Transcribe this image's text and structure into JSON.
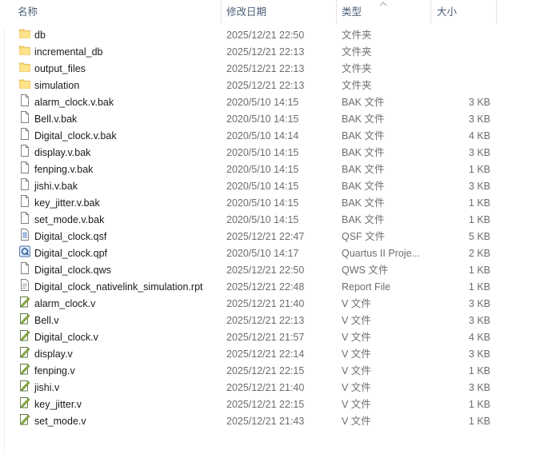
{
  "columns": {
    "name": "名称",
    "date": "修改日期",
    "type": "类型",
    "size": "大小"
  },
  "sort": {
    "column": "type",
    "direction": "ascending",
    "icon": "sort-up-icon"
  },
  "files": [
    {
      "name": "db",
      "date": "2025/12/21 22:50",
      "type": "文件夹",
      "size": "",
      "icon": "folder-icon"
    },
    {
      "name": "incremental_db",
      "date": "2025/12/21 22:13",
      "type": "文件夹",
      "size": "",
      "icon": "folder-icon"
    },
    {
      "name": "output_files",
      "date": "2025/12/21 22:13",
      "type": "文件夹",
      "size": "",
      "icon": "folder-icon"
    },
    {
      "name": "simulation",
      "date": "2025/12/21 22:13",
      "type": "文件夹",
      "size": "",
      "icon": "folder-icon"
    },
    {
      "name": "alarm_clock.v.bak",
      "date": "2020/5/10 14:15",
      "type": "BAK 文件",
      "size": "3 KB",
      "icon": "file-icon"
    },
    {
      "name": "Bell.v.bak",
      "date": "2020/5/10 14:15",
      "type": "BAK 文件",
      "size": "3 KB",
      "icon": "file-icon"
    },
    {
      "name": "Digital_clock.v.bak",
      "date": "2020/5/10 14:14",
      "type": "BAK 文件",
      "size": "4 KB",
      "icon": "file-icon"
    },
    {
      "name": "display.v.bak",
      "date": "2020/5/10 14:15",
      "type": "BAK 文件",
      "size": "3 KB",
      "icon": "file-icon"
    },
    {
      "name": "fenping.v.bak",
      "date": "2020/5/10 14:15",
      "type": "BAK 文件",
      "size": "1 KB",
      "icon": "file-icon"
    },
    {
      "name": "jishi.v.bak",
      "date": "2020/5/10 14:15",
      "type": "BAK 文件",
      "size": "3 KB",
      "icon": "file-icon"
    },
    {
      "name": "key_jitter.v.bak",
      "date": "2020/5/10 14:15",
      "type": "BAK 文件",
      "size": "1 KB",
      "icon": "file-icon"
    },
    {
      "name": "set_mode.v.bak",
      "date": "2020/5/10 14:15",
      "type": "BAK 文件",
      "size": "1 KB",
      "icon": "file-icon"
    },
    {
      "name": "Digital_clock.qsf",
      "date": "2025/12/21 22:47",
      "type": "QSF 文件",
      "size": "5 KB",
      "icon": "settings-file-icon"
    },
    {
      "name": "Digital_clock.qpf",
      "date": "2020/5/10 14:17",
      "type": "Quartus II Proje...",
      "size": "2 KB",
      "icon": "quartus-project-icon"
    },
    {
      "name": "Digital_clock.qws",
      "date": "2025/12/21 22:50",
      "type": "QWS 文件",
      "size": "1 KB",
      "icon": "file-icon"
    },
    {
      "name": "Digital_clock_nativelink_simulation.rpt",
      "date": "2025/12/21 22:48",
      "type": "Report File",
      "size": "1 KB",
      "icon": "report-file-icon"
    },
    {
      "name": "alarm_clock.v",
      "date": "2025/12/21 21:40",
      "type": "V 文件",
      "size": "3 KB",
      "icon": "verilog-file-icon"
    },
    {
      "name": "Bell.v",
      "date": "2025/12/21 22:13",
      "type": "V 文件",
      "size": "3 KB",
      "icon": "verilog-file-icon"
    },
    {
      "name": "Digital_clock.v",
      "date": "2025/12/21 21:57",
      "type": "V 文件",
      "size": "4 KB",
      "icon": "verilog-file-icon"
    },
    {
      "name": "display.v",
      "date": "2025/12/21 22:14",
      "type": "V 文件",
      "size": "3 KB",
      "icon": "verilog-file-icon"
    },
    {
      "name": "fenping.v",
      "date": "2025/12/21 22:15",
      "type": "V 文件",
      "size": "1 KB",
      "icon": "verilog-file-icon"
    },
    {
      "name": "jishi.v",
      "date": "2025/12/21 21:40",
      "type": "V 文件",
      "size": "3 KB",
      "icon": "verilog-file-icon"
    },
    {
      "name": "key_jitter.v",
      "date": "2025/12/21 22:15",
      "type": "V 文件",
      "size": "1 KB",
      "icon": "verilog-file-icon"
    },
    {
      "name": "set_mode.v",
      "date": "2025/12/21 21:43",
      "type": "V 文件",
      "size": "1 KB",
      "icon": "verilog-file-icon"
    }
  ]
}
